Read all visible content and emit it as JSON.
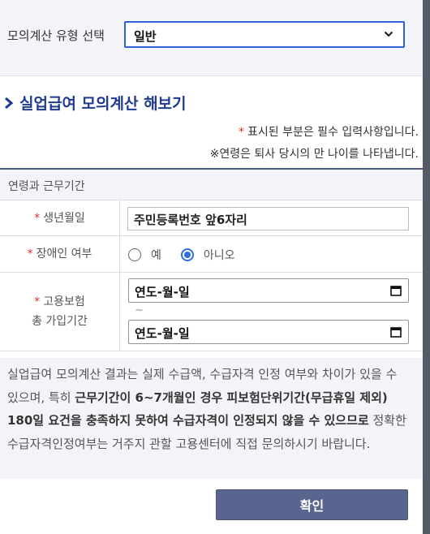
{
  "type_select": {
    "label": "모의계산 유형 선택",
    "value": "일반"
  },
  "section": {
    "title": "실업급여 모의계산 해보기"
  },
  "notes": {
    "required_mark": "*",
    "required": "표시된 부분은 필수 입력사항입니다.",
    "age": "※연령은 퇴사 당시의 만 나이를 나타냅니다."
  },
  "form": {
    "header": "연령과 근무기간",
    "birth": {
      "label": "생년월일",
      "placeholder": "주민등록번호 앞6자리"
    },
    "disability": {
      "label": "장애인 여부",
      "options": [
        "예",
        "아니오"
      ],
      "selected": "아니오"
    },
    "insurance": {
      "label_line1": "고용보험",
      "label_line2": "총 가입기간",
      "start": "연도-월-일",
      "separator": "~",
      "end": "연도-월-일"
    }
  },
  "info": {
    "part1": "실업급여 모의계산 결과는 실제 수급액, 수급자격 인정 여부와 차이가 있을 수 있으며, 특히 ",
    "bold": "근무기간이 6~7개월인 경우 피보험단위기간(무급휴일 제외) 180일 요건을 충족하지 못하여 수급자격이 인정되지 않을 수 있으므로",
    "part2": " 정확한 수급자격인정여부는 거주지 관할 고용센터에 직접 문의하시기 바랍니다."
  },
  "confirm_label": "확인",
  "colors": {
    "title": "#1f3b8f",
    "required": "#e0312f",
    "button": "#59648f",
    "select_border": "#2f5fd9",
    "radio_checked": "#2f6fe0"
  }
}
